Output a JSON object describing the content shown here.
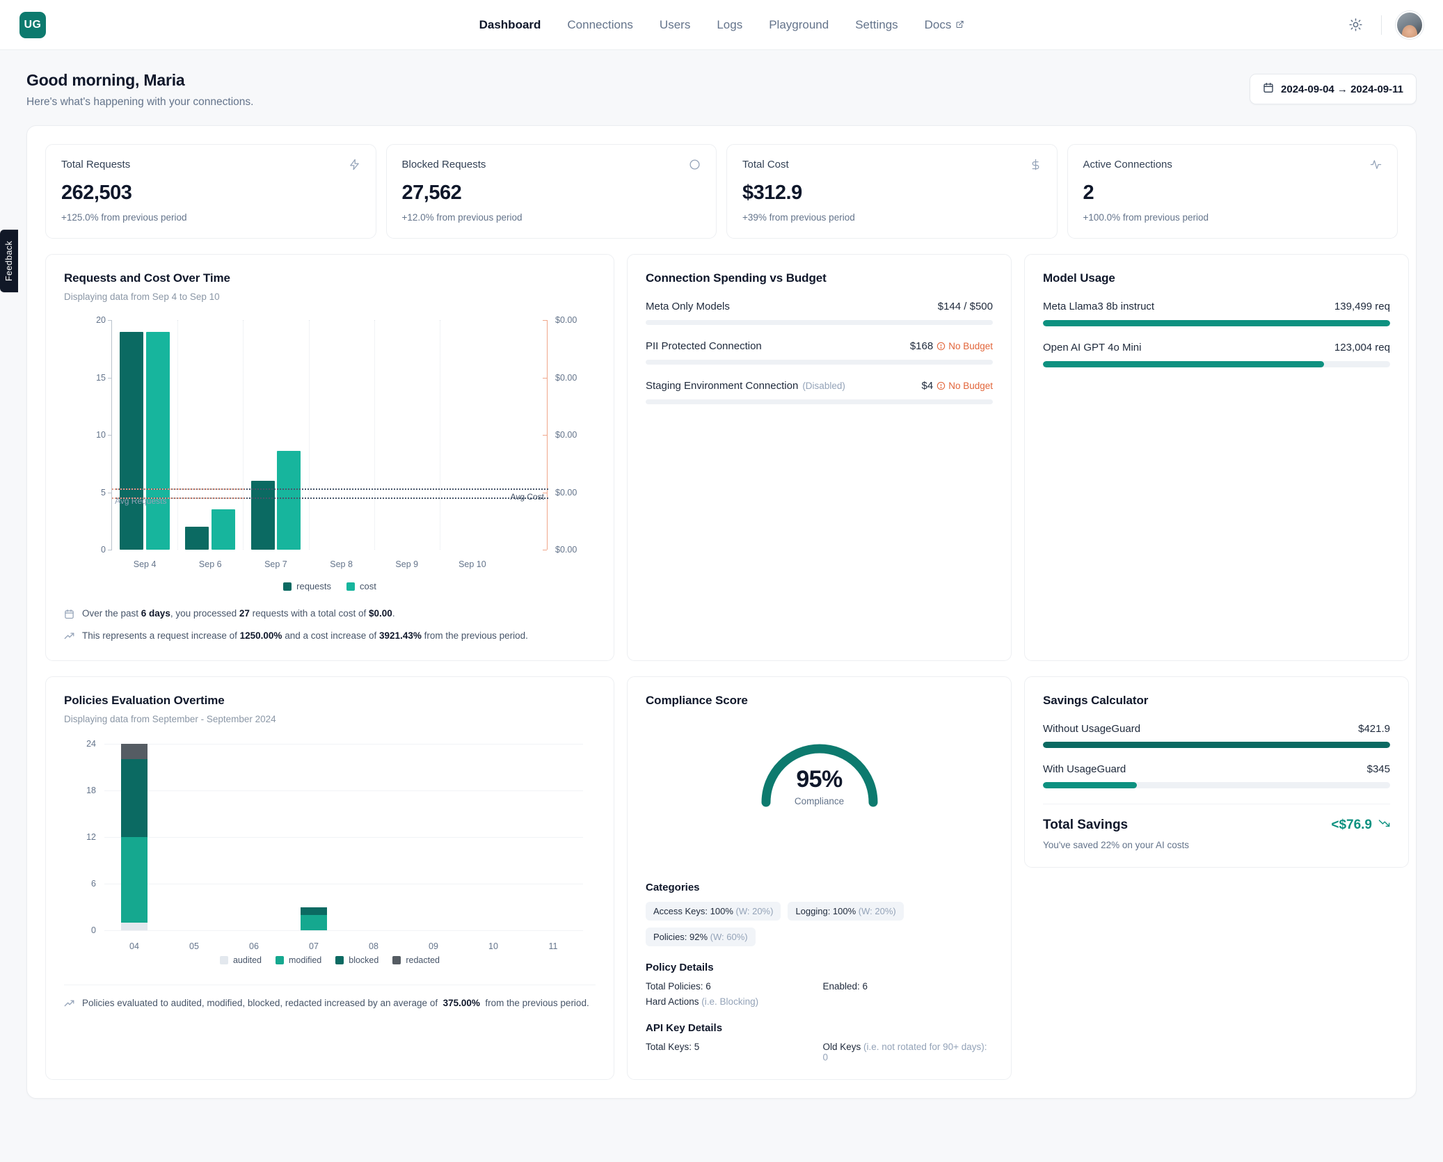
{
  "nav": {
    "logo_text": "UG",
    "links": [
      {
        "label": "Dashboard",
        "active": true,
        "external": false
      },
      {
        "label": "Connections",
        "active": false,
        "external": false
      },
      {
        "label": "Users",
        "active": false,
        "external": false
      },
      {
        "label": "Logs",
        "active": false,
        "external": false
      },
      {
        "label": "Playground",
        "active": false,
        "external": false
      },
      {
        "label": "Settings",
        "active": false,
        "external": false
      },
      {
        "label": "Docs",
        "active": false,
        "external": true
      }
    ],
    "theme_toggle_icon": "sun-icon",
    "avatar_alt": "user-avatar"
  },
  "feedback_tab": "Feedback",
  "header": {
    "greeting": "Good morning, Maria",
    "subtitle": "Here's what's happening with your connections.",
    "date_range": "2024-09-04 → 2024-09-11",
    "calendar_icon": "calendar-icon"
  },
  "kpis": [
    {
      "label": "Total Requests",
      "value": "262,503",
      "delta": "+125.0% from previous period",
      "icon": "lightning-icon"
    },
    {
      "label": "Blocked Requests",
      "value": "27,562",
      "delta": "+12.0% from previous period",
      "icon": "shield-icon"
    },
    {
      "label": "Total Cost",
      "value": "$312.9",
      "delta": "+39% from previous period",
      "icon": "dollar-icon"
    },
    {
      "label": "Active Connections",
      "value": "2",
      "delta": "+100.0% from previous period",
      "icon": "activity-icon"
    }
  ],
  "requests_cost": {
    "title": "Requests and Cost Over Time",
    "subtitle": "Displaying data from Sep 4 to Sep 10",
    "legend": [
      {
        "label": "requests",
        "color": "#0b6a62"
      },
      {
        "label": "cost",
        "color": "#17b59d"
      }
    ],
    "notes": [
      {
        "icon": "calendar-icon",
        "html": "Over the past <b>6 days</b>, you processed <b>27</b> requests with a total cost of <b>$0.00</b>."
      },
      {
        "icon": "trend-up-icon",
        "html": "This represents a request increase of <b>1250.00%</b> and a cost increase of <b>3921.43%</b> from the previous period."
      }
    ]
  },
  "spending": {
    "title": "Connection Spending vs Budget",
    "rows": [
      {
        "name": "Meta Only Models",
        "disabled_tag": "",
        "value": "$144 / $500",
        "no_budget": "",
        "pct": 0
      },
      {
        "name": "PII Protected Connection",
        "disabled_tag": "",
        "value": "$168",
        "no_budget": "No Budget",
        "pct": 0
      },
      {
        "name": "Staging Environment Connection",
        "disabled_tag": "(Disabled)",
        "value": "$4",
        "no_budget": "No Budget",
        "pct": 0
      }
    ]
  },
  "model_usage": {
    "title": "Model Usage",
    "rows": [
      {
        "name": "Meta Llama3 8b instruct",
        "value": "139,499 req",
        "pct": 100
      },
      {
        "name": "Open AI GPT 4o Mini",
        "value": "123,004 req",
        "pct": 81
      }
    ]
  },
  "policies": {
    "title": "Policies Evaluation Overtime",
    "subtitle": "Displaying data from September - September 2024",
    "legend": [
      {
        "label": "audited",
        "color": "#e3e8ee"
      },
      {
        "label": "modified",
        "color": "#15a88f"
      },
      {
        "label": "blocked",
        "color": "#0b6a62"
      },
      {
        "label": "redacted",
        "color": "#555c63"
      }
    ],
    "note": {
      "icon": "trend-up-icon",
      "html": "Policies evaluated to audited, modified, blocked, redacted increased by an average of &nbsp;<b>375.00%</b>&nbsp; from the previous period."
    }
  },
  "compliance": {
    "title": "Compliance Score",
    "percent": "95%",
    "caption": "Compliance",
    "gauge_color": "#0d7a6e",
    "categories_title": "Categories",
    "categories": [
      {
        "label": "Access Keys: 100%",
        "weight": "(W: 20%)"
      },
      {
        "label": "Logging: 100%",
        "weight": "(W: 20%)"
      },
      {
        "label": "Policies: 92%",
        "weight": "(W: 60%)"
      }
    ],
    "policy_details_title": "Policy Details",
    "policy_details": [
      {
        "label": "Total Policies: 6",
        "dim": ""
      },
      {
        "label": "Enabled: 6",
        "dim": ""
      },
      {
        "label": "Hard Actions ",
        "dim": "(i.e. Blocking)"
      },
      {
        "label": "",
        "dim": ""
      }
    ],
    "api_key_title": "API Key Details",
    "api_key_details": [
      {
        "label": "Total Keys: 5",
        "dim": ""
      },
      {
        "label": "Old Keys ",
        "dim": "(i.e. not rotated for 90+ days): 0"
      }
    ]
  },
  "savings": {
    "title": "Savings Calculator",
    "rows": [
      {
        "name": "Without UsageGuard",
        "value": "$421.9",
        "pct": 100,
        "color": "#0b6a62"
      },
      {
        "name": "With UsageGuard",
        "value": "$345",
        "pct": 27,
        "color": "#0d9180"
      }
    ],
    "total_label": "Total Savings",
    "total_value": "<$76.9",
    "trend_icon": "trend-down-icon",
    "sub": "You've saved 22% on your AI costs"
  },
  "chart_data": [
    {
      "type": "bar",
      "title": "Requests and Cost Over Time",
      "subtitle": "Displaying data from Sep 4 to Sep 10",
      "categories": [
        "Sep 4",
        "Sep 6",
        "Sep 7",
        "Sep 8",
        "Sep 9",
        "Sep 10"
      ],
      "series": [
        {
          "name": "requests",
          "color": "#0b6a62",
          "values": [
            19,
            2,
            6,
            0,
            0,
            0
          ]
        },
        {
          "name": "cost",
          "color": "#17b59d",
          "values": [
            19,
            3.5,
            8.6,
            0,
            0,
            0
          ]
        }
      ],
      "ylabel": "",
      "ylim": [
        0,
        20
      ],
      "yticks": [
        0,
        5,
        10,
        15,
        20
      ],
      "y2ticks_labels": [
        "$0.00",
        "$0.00",
        "$0.00",
        "$0.00",
        "$0.00"
      ],
      "y2_axis_color": "#f0a68a",
      "reference_lines": [
        {
          "label": "Avg Requests",
          "value": 5.2,
          "color": "#e39a86"
        },
        {
          "label": "Avg Cost",
          "value": 4.4,
          "color": "#475569"
        }
      ],
      "grid": true,
      "legend_position": "bottom"
    },
    {
      "type": "bar",
      "stacked": true,
      "title": "Policies Evaluation Overtime",
      "subtitle": "Displaying data from September - September 2024",
      "categories": [
        "04",
        "05",
        "06",
        "07",
        "08",
        "09",
        "10",
        "11"
      ],
      "series": [
        {
          "name": "audited",
          "color": "#e3e8ee",
          "values": [
            1,
            0,
            0,
            0,
            0,
            0,
            0,
            0
          ]
        },
        {
          "name": "modified",
          "color": "#15a88f",
          "values": [
            11,
            0,
            0,
            2,
            0,
            0,
            0,
            0
          ]
        },
        {
          "name": "blocked",
          "color": "#0b6a62",
          "values": [
            10,
            0,
            0,
            1,
            0,
            0,
            0,
            0
          ]
        },
        {
          "name": "redacted",
          "color": "#555c63",
          "values": [
            2,
            0,
            0,
            0,
            0,
            0,
            0,
            0
          ]
        }
      ],
      "ylim": [
        0,
        24
      ],
      "yticks": [
        0,
        6,
        12,
        18,
        24
      ],
      "grid": true,
      "legend_position": "bottom"
    },
    {
      "type": "gauge",
      "title": "Compliance Score",
      "value": 95,
      "max": 100,
      "label": "Compliance",
      "color": "#0d7a6e"
    }
  ]
}
